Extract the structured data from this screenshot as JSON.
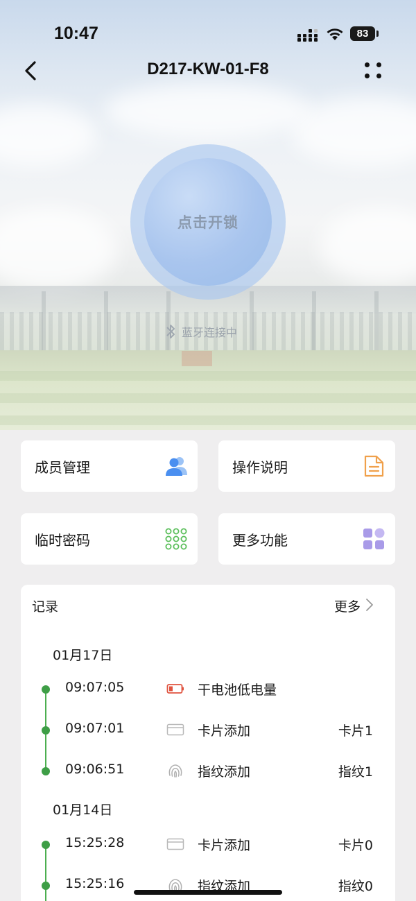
{
  "status_bar": {
    "time": "10:47",
    "battery": "83"
  },
  "nav": {
    "title": "D217-KW-01-F8"
  },
  "unlock": {
    "label": "点击开锁",
    "bluetooth_status": "蓝牙连接中"
  },
  "cards": [
    {
      "label": "成员管理",
      "icon": "members-icon",
      "color": "#4a8ff0"
    },
    {
      "label": "操作说明",
      "icon": "document-icon",
      "color": "#f0a04b"
    },
    {
      "label": "临时密码",
      "icon": "keypad-icon",
      "color": "#5cbf5c"
    },
    {
      "label": "更多功能",
      "icon": "grid-icon",
      "color": "#a99be8"
    }
  ],
  "records": {
    "title": "记录",
    "more_label": "更多",
    "groups": [
      {
        "date": "01月17日",
        "items": [
          {
            "time": "09:07:05",
            "event": "干电池低电量",
            "value": "",
            "icon": "low-battery-icon"
          },
          {
            "time": "09:07:01",
            "event": "卡片添加",
            "value": "卡片1",
            "icon": "card-icon"
          },
          {
            "time": "09:06:51",
            "event": "指纹添加",
            "value": "指纹1",
            "icon": "fingerprint-icon"
          }
        ]
      },
      {
        "date": "01月14日",
        "items": [
          {
            "time": "15:25:28",
            "event": "卡片添加",
            "value": "卡片0",
            "icon": "card-icon"
          },
          {
            "time": "15:25:16",
            "event": "指纹添加",
            "value": "指纹0",
            "icon": "fingerprint-icon"
          }
        ]
      }
    ]
  },
  "colors": {
    "accent_green": "#3e9e46",
    "low_battery_red": "#e0533f",
    "unlock_blue": "#a9c5ee"
  }
}
